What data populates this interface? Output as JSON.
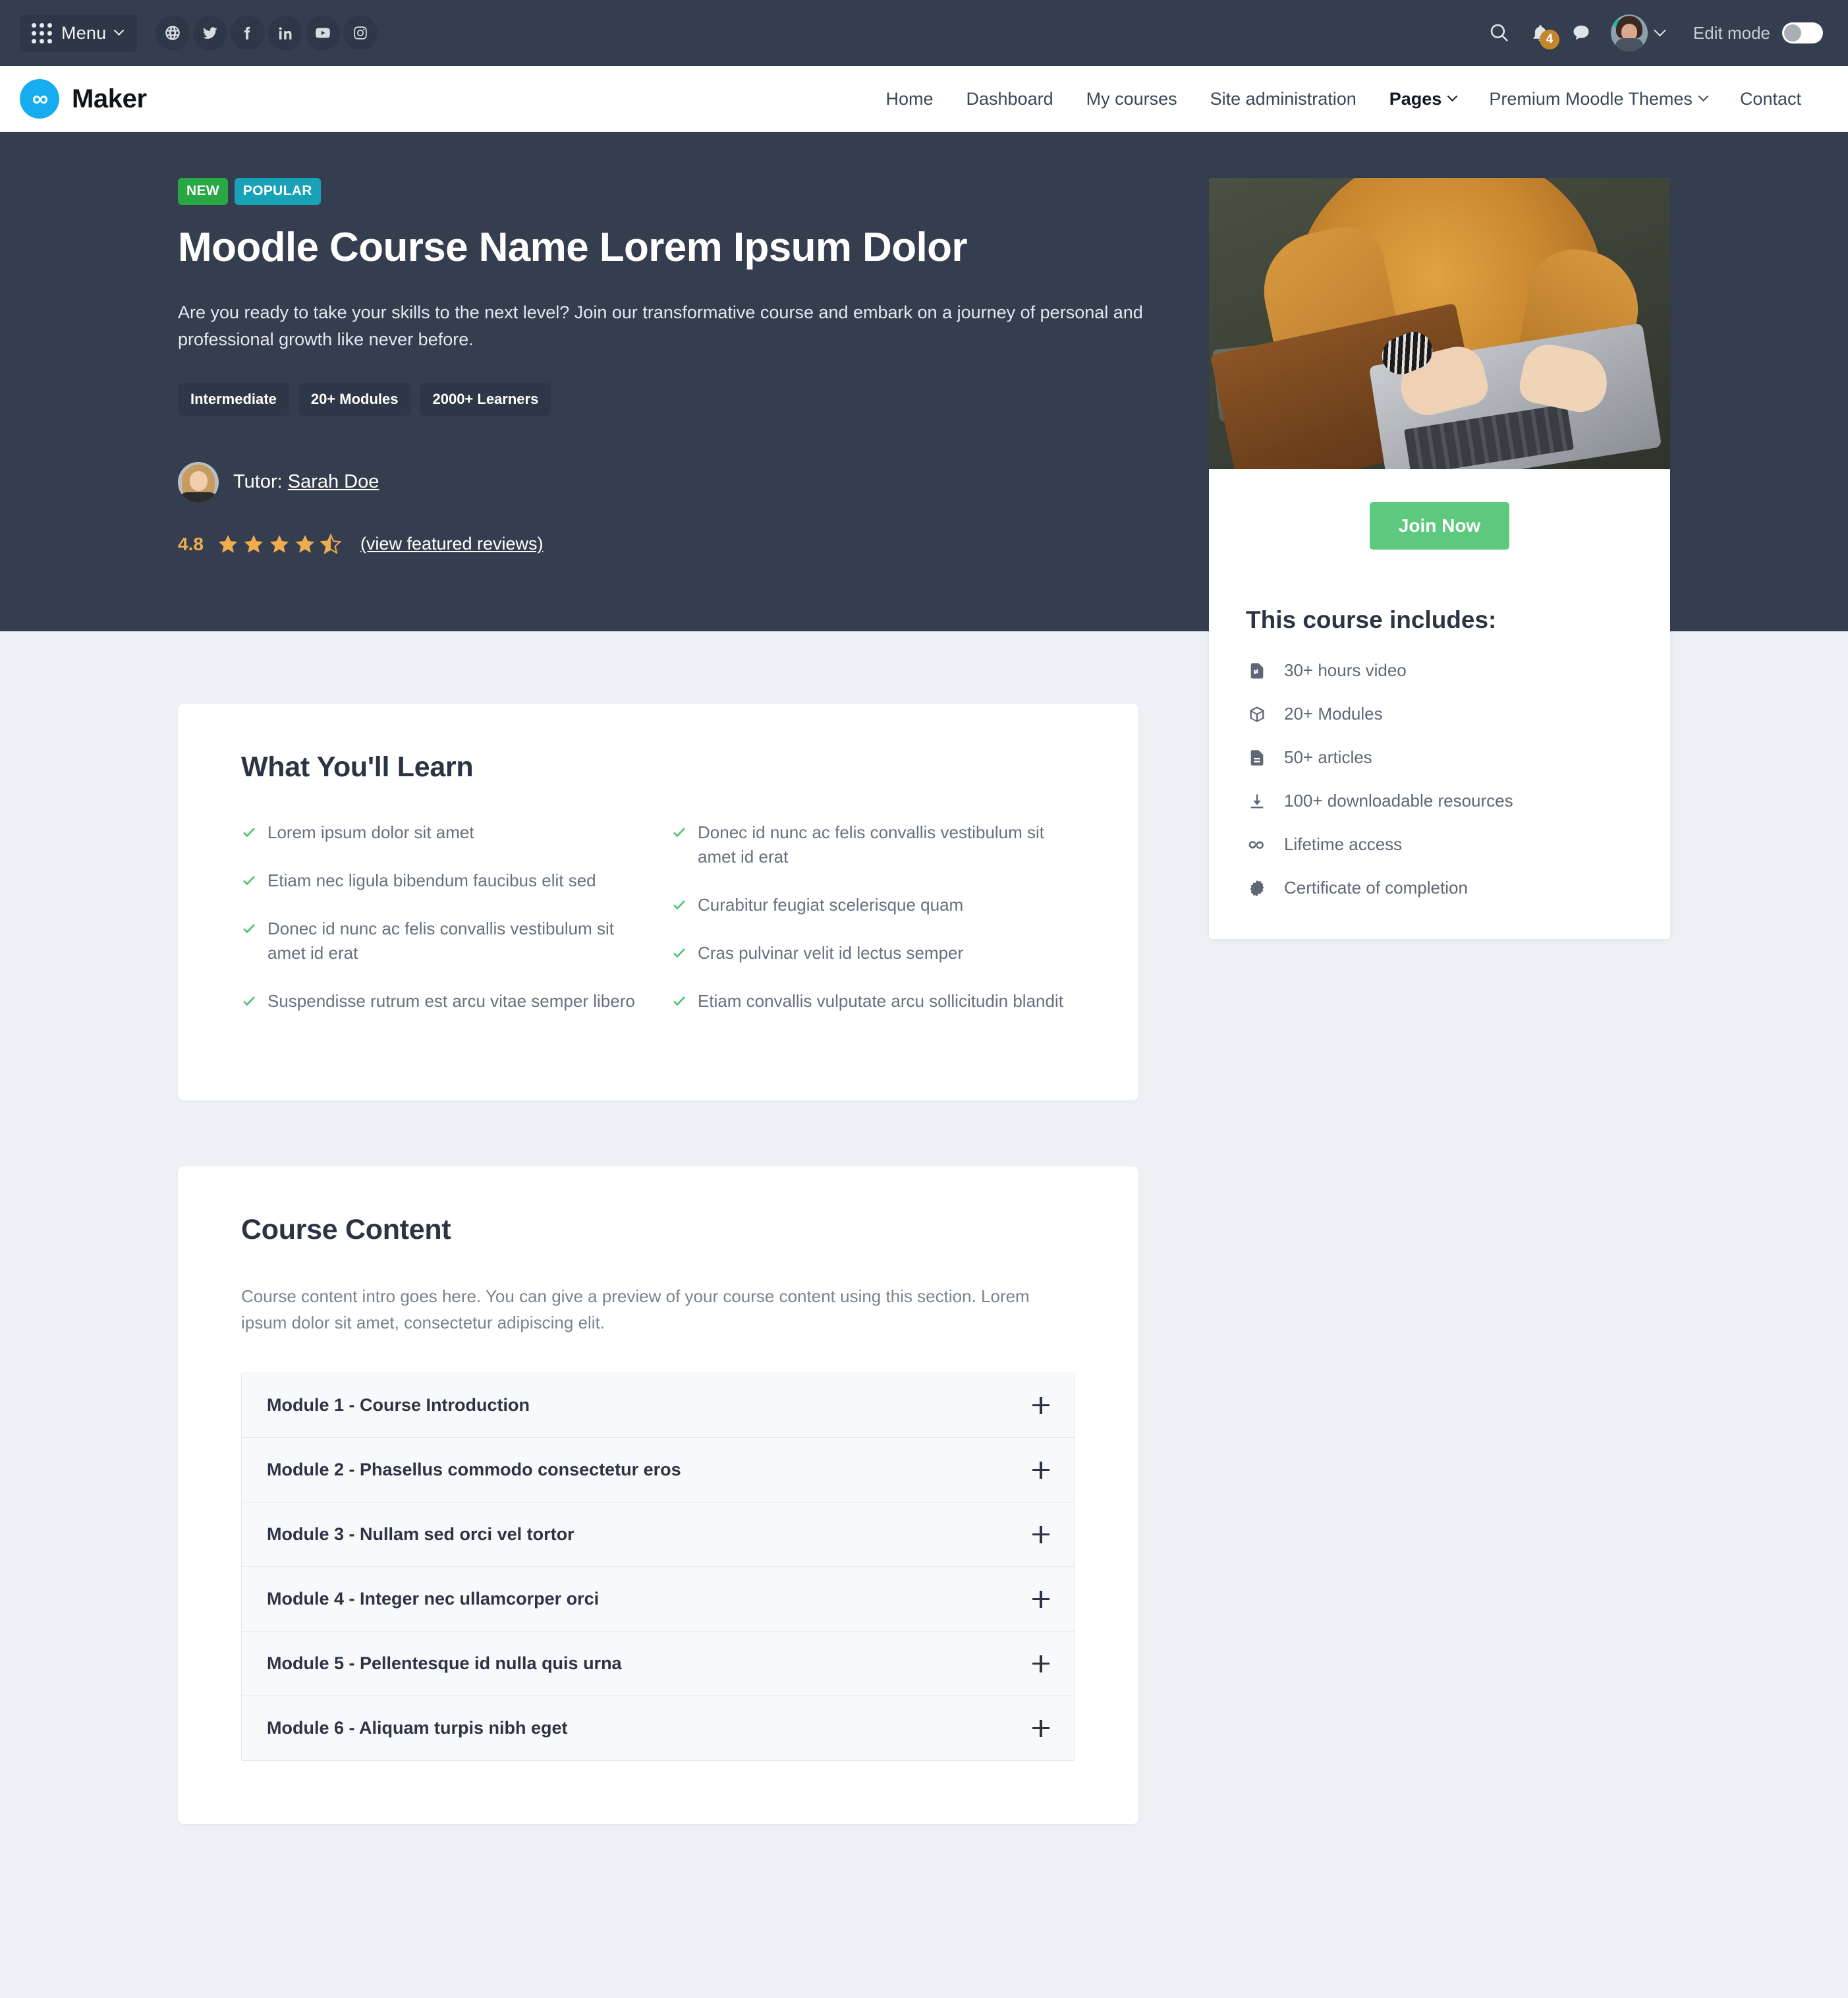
{
  "topbar": {
    "menu_label": "Menu",
    "social": [
      {
        "name": "globe-icon"
      },
      {
        "name": "twitter-icon"
      },
      {
        "name": "facebook-icon"
      },
      {
        "name": "linkedin-icon"
      },
      {
        "name": "youtube-icon"
      },
      {
        "name": "instagram-icon"
      }
    ],
    "notification_count": "4",
    "edit_mode_label": "Edit mode",
    "edit_mode_on": false
  },
  "navbar": {
    "brand": "Maker",
    "links": [
      {
        "label": "Home",
        "caret": false,
        "active": false
      },
      {
        "label": "Dashboard",
        "caret": false,
        "active": false
      },
      {
        "label": "My courses",
        "caret": false,
        "active": false
      },
      {
        "label": "Site administration",
        "caret": false,
        "active": false
      },
      {
        "label": "Pages",
        "caret": true,
        "active": true
      },
      {
        "label": "Premium Moodle Themes",
        "caret": true,
        "active": false
      },
      {
        "label": "Contact",
        "caret": false,
        "active": false
      }
    ]
  },
  "hero": {
    "badges": [
      {
        "label": "NEW",
        "color": "#28a745"
      },
      {
        "label": "POPULAR",
        "color": "#17a2b8"
      }
    ],
    "title": "Moodle Course Name Lorem Ipsum Dolor",
    "subtitle": "Are you ready to take your skills to the next level? Join our transformative course and embark on a journey of personal and professional growth like never before.",
    "tags": [
      "Intermediate",
      "20+ Modules",
      "2000+ Learners"
    ],
    "tutor_prefix": "Tutor:",
    "tutor_name": "Sarah Doe",
    "rating_value": "4.8",
    "stars_full": 4,
    "stars_half": 1,
    "star_color": "#f0ad4e",
    "reviews_link": "(view featured reviews)"
  },
  "side_card": {
    "join_label": "Join Now",
    "join_color": "#5cc97f",
    "includes_title": "This course includes:",
    "includes": [
      {
        "icon": "file-video-icon",
        "label": "30+ hours video"
      },
      {
        "icon": "package-icon",
        "label": "20+ Modules"
      },
      {
        "icon": "file-text-icon",
        "label": "50+ articles"
      },
      {
        "icon": "download-icon",
        "label": "100+ downloadable resources"
      },
      {
        "icon": "infinity-icon",
        "label": "Lifetime access"
      },
      {
        "icon": "certificate-icon",
        "label": "Certificate of completion"
      }
    ]
  },
  "learn": {
    "heading": "What You'll Learn",
    "col_left": [
      "Lorem ipsum dolor sit amet",
      "Etiam nec ligula bibendum faucibus elit sed",
      "Donec id nunc ac felis convallis vestibulum sit amet id erat",
      "Suspendisse rutrum est arcu vitae semper libero"
    ],
    "col_right": [
      "Donec id nunc ac felis convallis vestibulum sit amet id erat",
      "Curabitur feugiat scelerisque quam",
      "Cras pulvinar velit id lectus semper",
      "Etiam convallis vulputate arcu sollicitudin blandit"
    ]
  },
  "course_content": {
    "heading": "Course Content",
    "intro": "Course content intro goes here. You can give a preview of your course content using this section. Lorem ipsum dolor sit amet, consectetur adipiscing elit.",
    "modules": [
      "Module 1 - Course Introduction",
      "Module 2 - Phasellus commodo consectetur eros",
      "Module 3 - Nullam sed orci vel tortor",
      "Module 4 - Integer nec ullamcorper orci",
      "Module 5 - Pellentesque id nulla quis urna",
      "Module 6 - Aliquam turpis nibh eget"
    ]
  }
}
